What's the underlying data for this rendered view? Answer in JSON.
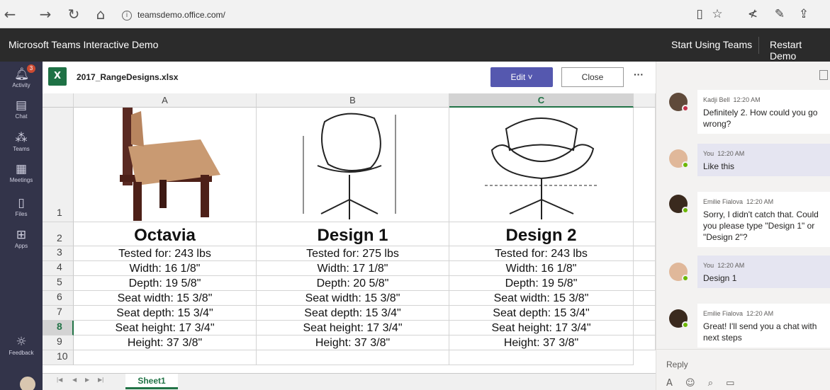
{
  "browser": {
    "url": "teamsdemo.office.com/",
    "back_icon": "←",
    "forward_icon": "→",
    "refresh_icon": "↻",
    "home_icon": "⌂",
    "reading_icon": "▯",
    "favorite_icon": "☆",
    "favorites_list_icon": "≮",
    "pen_icon": "✎",
    "share_icon": "⇪"
  },
  "teams": {
    "title": "Microsoft Teams Interactive Demo",
    "start_label": "Start Using Teams",
    "restart_label": "Restart Demo"
  },
  "rail": {
    "activity": "Activity",
    "activity_badge": "3",
    "chat": "Chat",
    "teams": "Teams",
    "meetings": "Meetings",
    "files": "Files",
    "apps": "Apps",
    "feedback": "Feedback"
  },
  "excel": {
    "logo": "X",
    "filename": "2017_RangeDesigns.xlsx",
    "edit_label": "Edit ˅",
    "close_label": "Close",
    "more_label": "···",
    "columns": [
      "A",
      "B",
      "C"
    ],
    "rows": [
      "1",
      "2",
      "3",
      "4",
      "5",
      "6",
      "7",
      "8",
      "9",
      "10"
    ],
    "names": [
      "Octavia",
      "Design 1",
      "Design 2"
    ],
    "specs": [
      [
        "Tested for: 243 lbs",
        "Tested for: 275 lbs",
        "Tested for: 243 lbs"
      ],
      [
        "Width: 16 1/8\"",
        "Width: 17 1/8\"",
        "Width: 16 1/8\""
      ],
      [
        "Depth: 19 5/8\"",
        "Depth: 20 5/8\"",
        "Depth: 19 5/8\""
      ],
      [
        "Seat width: 15 3/8\"",
        "Seat width: 15 3/8\"",
        "Seat width: 15 3/8\""
      ],
      [
        "Seat depth: 15 3/4\"",
        "Seat depth: 15 3/4\"",
        "Seat depth: 15 3/4\""
      ],
      [
        "Seat height: 17 3/4\"",
        "Seat height: 17 3/4\"",
        "Seat height: 17 3/4\""
      ],
      [
        "Height: 37 3/8\"",
        "Height: 37 3/8\"",
        "Height: 37 3/8\""
      ]
    ],
    "sheet_tab": "Sheet1",
    "selected_column": "C",
    "selected_row": "8"
  },
  "chat": {
    "messages": [
      {
        "author": "Kadji Bell",
        "time": "12:20 AM",
        "text": "Definitely 2. How could you go wrong?",
        "me": false
      },
      {
        "author": "You",
        "time": "12:20 AM",
        "text": "Like this",
        "me": true
      },
      {
        "author": "Emilie Fialova",
        "time": "12:20 AM",
        "text": "Sorry, I didn't catch that. Could you please type \"Design 1\" or \"Design 2\"?",
        "me": false
      },
      {
        "author": "You",
        "time": "12:20 AM",
        "text": "Design 1",
        "me": true
      },
      {
        "author": "Emilie Fialova",
        "time": "12:20 AM",
        "text": "Great! I'll send you a chat with next steps",
        "me": false
      }
    ],
    "reply_placeholder": "Reply",
    "format_icon": "A",
    "emoji_icon": "☺",
    "attach_icon": "⌕",
    "meet_icon": "▭"
  },
  "colors": {
    "teams_purple": "#5558af",
    "excel_green": "#217346",
    "rail_bg": "#33344a"
  }
}
